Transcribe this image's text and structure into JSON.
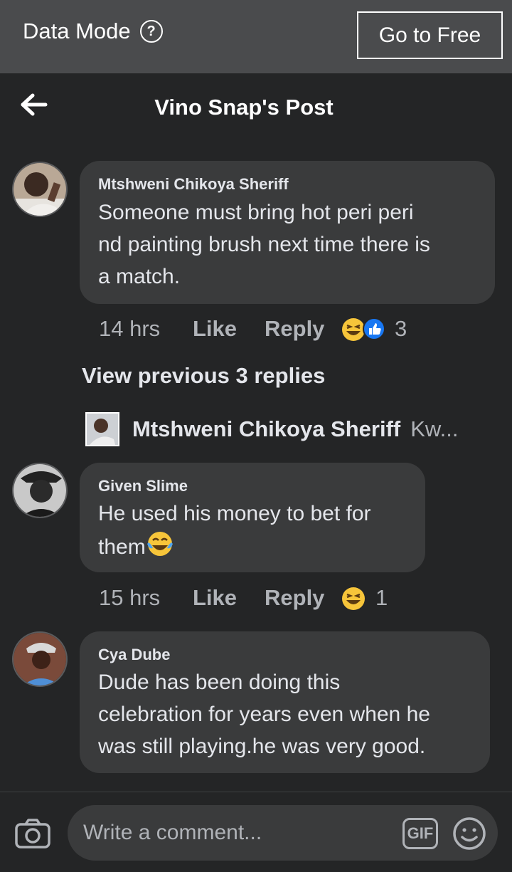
{
  "data_mode": {
    "label": "Data Mode",
    "help_icon": "?",
    "go_free": "Go to Free"
  },
  "header": {
    "title": "Vino Snap's Post",
    "back_icon": "back-arrow-icon"
  },
  "comments": [
    {
      "author": "Mtshweni Chikoya Sheriff",
      "lines": [
        "Someone must bring hot peri peri",
        "nd painting brush next time there is",
        "a match."
      ],
      "time": "14 hrs",
      "like": "Like",
      "reply": "Reply",
      "reaction_count": "3"
    },
    {
      "author": "Given Slime",
      "lines": [
        "He used his money to bet for",
        "them"
      ],
      "time": "15 hrs",
      "like": "Like",
      "reply": "Reply",
      "reaction_count": "1"
    },
    {
      "author": "Cya Dube",
      "lines": [
        "Dude has been doing this",
        "celebration for years even when he",
        "was still playing.he was very good."
      ]
    }
  ],
  "replies": {
    "view_previous": "View previous 3 replies",
    "latest_author": "Mtshweni Chikoya Sheriff",
    "latest_snippet": "Kw..."
  },
  "composer": {
    "placeholder": "Write a comment...",
    "gif": "GIF"
  },
  "colors": {
    "bg": "#242526",
    "bubble": "#3a3b3c",
    "bar": "#4a4b4d",
    "muted": "#b0b3b8"
  }
}
